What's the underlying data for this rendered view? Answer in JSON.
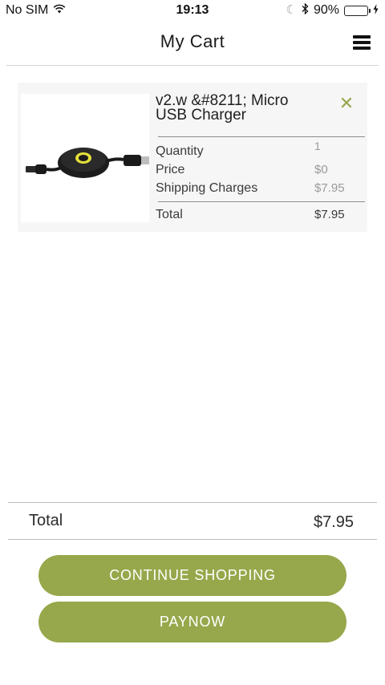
{
  "status_bar": {
    "carrier": "No SIM",
    "time": "19:13",
    "battery": "90%",
    "battery_level": 0.9,
    "icons": [
      "wifi-icon",
      "moon-icon",
      "bluetooth-icon",
      "battery-icon",
      "charging-icon"
    ]
  },
  "header": {
    "title": "My Cart",
    "menu_icon": "hamburger-menu-icon"
  },
  "cart": {
    "items": [
      {
        "name": "v2.w &#8211; Micro USB Charger",
        "image": "retractable-micro-usb-cable",
        "remove_icon": "close-icon",
        "quantity_label": "Quantity",
        "quantity": "1",
        "price_label": "Price",
        "price": "$0",
        "shipping_label": "Shipping Charges",
        "shipping": "$7.95",
        "total_label": "Total",
        "total": "$7.95"
      }
    ]
  },
  "summary": {
    "total_label": "Total",
    "total_value": "$7.95"
  },
  "actions": {
    "continue_label": "CONTINUE SHOPPING",
    "pay_label": "PAYNOW"
  },
  "colors": {
    "accent": "#96a84b",
    "battery_fill": "#4cd964"
  }
}
